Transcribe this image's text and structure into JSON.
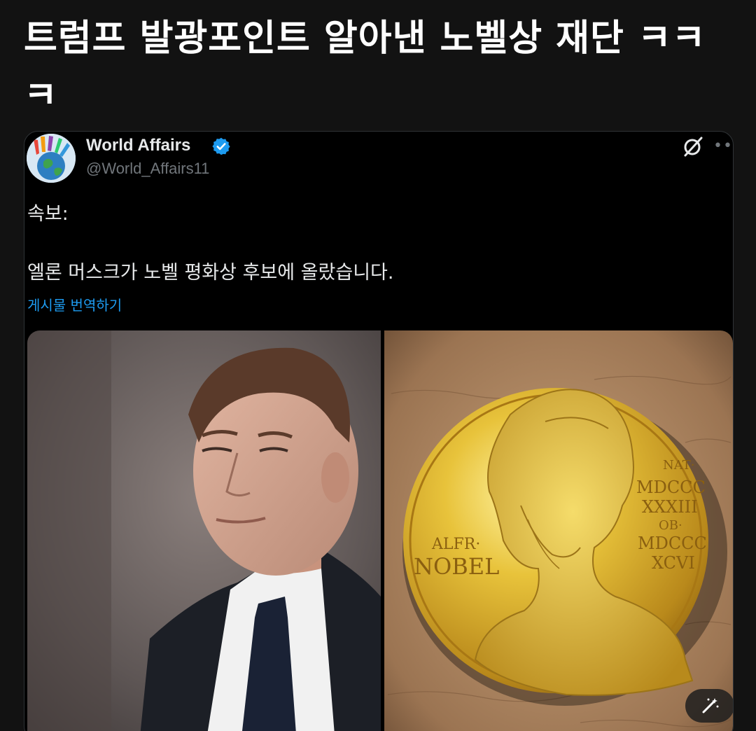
{
  "post": {
    "title": "트럼프 발광포인트 알아낸 노벨상 재단 ㅋㅋㅋ"
  },
  "tweet": {
    "author_name": "World Affairs",
    "author_handle": "@World_Affairs11",
    "text_line1": "속보:",
    "text_line2": "엘론 머스크가 노벨 평화상 후보에 올랐습니다.",
    "translate_label": "게시물 번역하기",
    "verified_color": "#1d9bf0",
    "link_color": "#1d9bf0"
  },
  "media": {
    "left_image": "portrait-photo",
    "right_image": "nobel-medal-photo",
    "medal": {
      "left_inscription_1": "ALFR·",
      "left_inscription_2": "NOBEL",
      "right_inscription_1": "NAT·",
      "right_inscription_2": "MDCCC",
      "right_inscription_3": "XXXIII",
      "right_inscription_4": "OB·",
      "right_inscription_5": "MDCCC",
      "right_inscription_6": "XCVI"
    }
  },
  "icons": {
    "verified": "verified-badge-icon",
    "grok": "grok-icon",
    "more": "more-icon",
    "image_edit": "magic-wand-icon"
  }
}
